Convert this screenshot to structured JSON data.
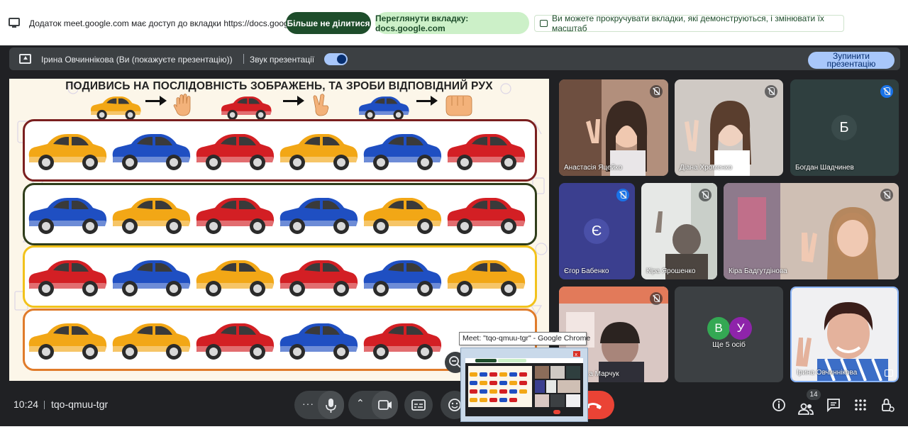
{
  "share_bar": {
    "message": "Додаток meet.google.com має доступ до вкладки https://docs.google.com",
    "stop_sharing": "Більше не ділитися",
    "view_tab": "Переглянути вкладку: docs.google.com",
    "hint": "Ви можете прокручувати вкладки, які демонструються, і змінювати їх масштаб"
  },
  "presenting_bar": {
    "presenter": "Ірина Овчиннікова (Ви (покажуєте презентацію))",
    "sound_label": "Звук презентації",
    "sound_on": true,
    "stop_line1": "Зупинити",
    "stop_line2": "презентацію"
  },
  "slide": {
    "title": "ПОДИВИСЬ НА ПОСЛІДОВНІСТЬ ЗОБРАЖЕНЬ, ТА ЗРОБИ ВІДПОВІДНИЙ РУХ",
    "legend": [
      {
        "car": "yellow",
        "gesture": "open-palm"
      },
      {
        "car": "red",
        "gesture": "two-fingers"
      },
      {
        "car": "blue",
        "gesture": "fist"
      }
    ],
    "rows": [
      {
        "border": "#7a1f1f",
        "cars": [
          "yellow",
          "blue",
          "red",
          "yellow",
          "blue",
          "red"
        ]
      },
      {
        "border": "#2f3d1a",
        "cars": [
          "blue",
          "yellow",
          "red",
          "blue",
          "yellow",
          "red"
        ]
      },
      {
        "border": "#f2c21b",
        "cars": [
          "red",
          "blue",
          "yellow",
          "red",
          "blue",
          "yellow"
        ]
      },
      {
        "border": "#e07b2a",
        "cars": [
          "yellow",
          "yellow",
          "red",
          "blue",
          "red"
        ]
      }
    ]
  },
  "colors": {
    "yellow": "#f2a716",
    "blue": "#1f4fc2",
    "red": "#d31f24"
  },
  "participants": [
    {
      "name": "Анастасія Яцейко"
    },
    {
      "name": "Діана Хроменко"
    },
    {
      "name": "Богдан Шадчинев",
      "initial": "Б"
    },
    {
      "name": "Єгор Бабенко",
      "initial": "Є"
    },
    {
      "name": "Кіра Ярошенко"
    },
    {
      "name": "Кіра Бадгутдінова"
    },
    {
      "name": "...а Марчук"
    },
    {
      "name": "Ще 5 осіб",
      "initials": [
        "В",
        "У"
      ]
    },
    {
      "name": "Ірина Овчиннікова"
    }
  ],
  "bottom_bar": {
    "time": "10:24",
    "meeting_code": "tqo-qmuu-tgr",
    "people_count": "14"
  },
  "tooltip": "Meet: \"tqo-qmuu-tgr\" - Google Chrome"
}
